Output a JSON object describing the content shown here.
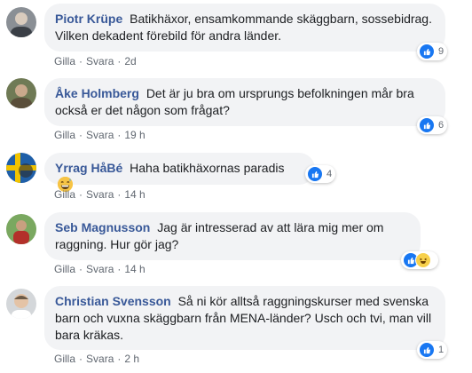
{
  "actions": {
    "like": "Gilla",
    "reply": "Svara",
    "separator": "·"
  },
  "comments": [
    {
      "author": "Piotr Krüpe",
      "text": "Batikhäxor, ensamkommande skäggbarn, sossebidrag. Vilken dekadent förebild för andra länder.",
      "time": "2d",
      "reaction_count": "9",
      "reactions": [
        "like"
      ]
    },
    {
      "author": "Åke Holmberg",
      "text": "Det är ju bra om ursprungs befolkningen mår bra också er det någon som frågat?",
      "time": "19 h",
      "reaction_count": "6",
      "reactions": [
        "like"
      ]
    },
    {
      "author": "Yrrag HåBé",
      "text": "Haha batikhäxornas paradis",
      "emoji": "grinning-sweat-emoji",
      "time": "14 h",
      "reaction_count": "4",
      "reactions": [
        "like"
      ]
    },
    {
      "author": "Seb Magnusson",
      "text": "Jag är intresserad av att lära mig mer om raggning. Hur gör jag?",
      "time": "14 h",
      "reaction_count": "",
      "reactions": [
        "like",
        "haha"
      ]
    },
    {
      "author": "Christian Svensson",
      "text": "Så ni kör alltså raggningskurser med svenska barn och vuxna skäggbarn från MENA-länder? Usch och tvi, man vill bara kräkas.",
      "time": "2 h",
      "reaction_count": "1",
      "reactions": [
        "like"
      ]
    }
  ],
  "colors": {
    "author": "#385898",
    "bubble": "#f2f3f5",
    "meta": "#606770",
    "like": "#1877f2"
  }
}
